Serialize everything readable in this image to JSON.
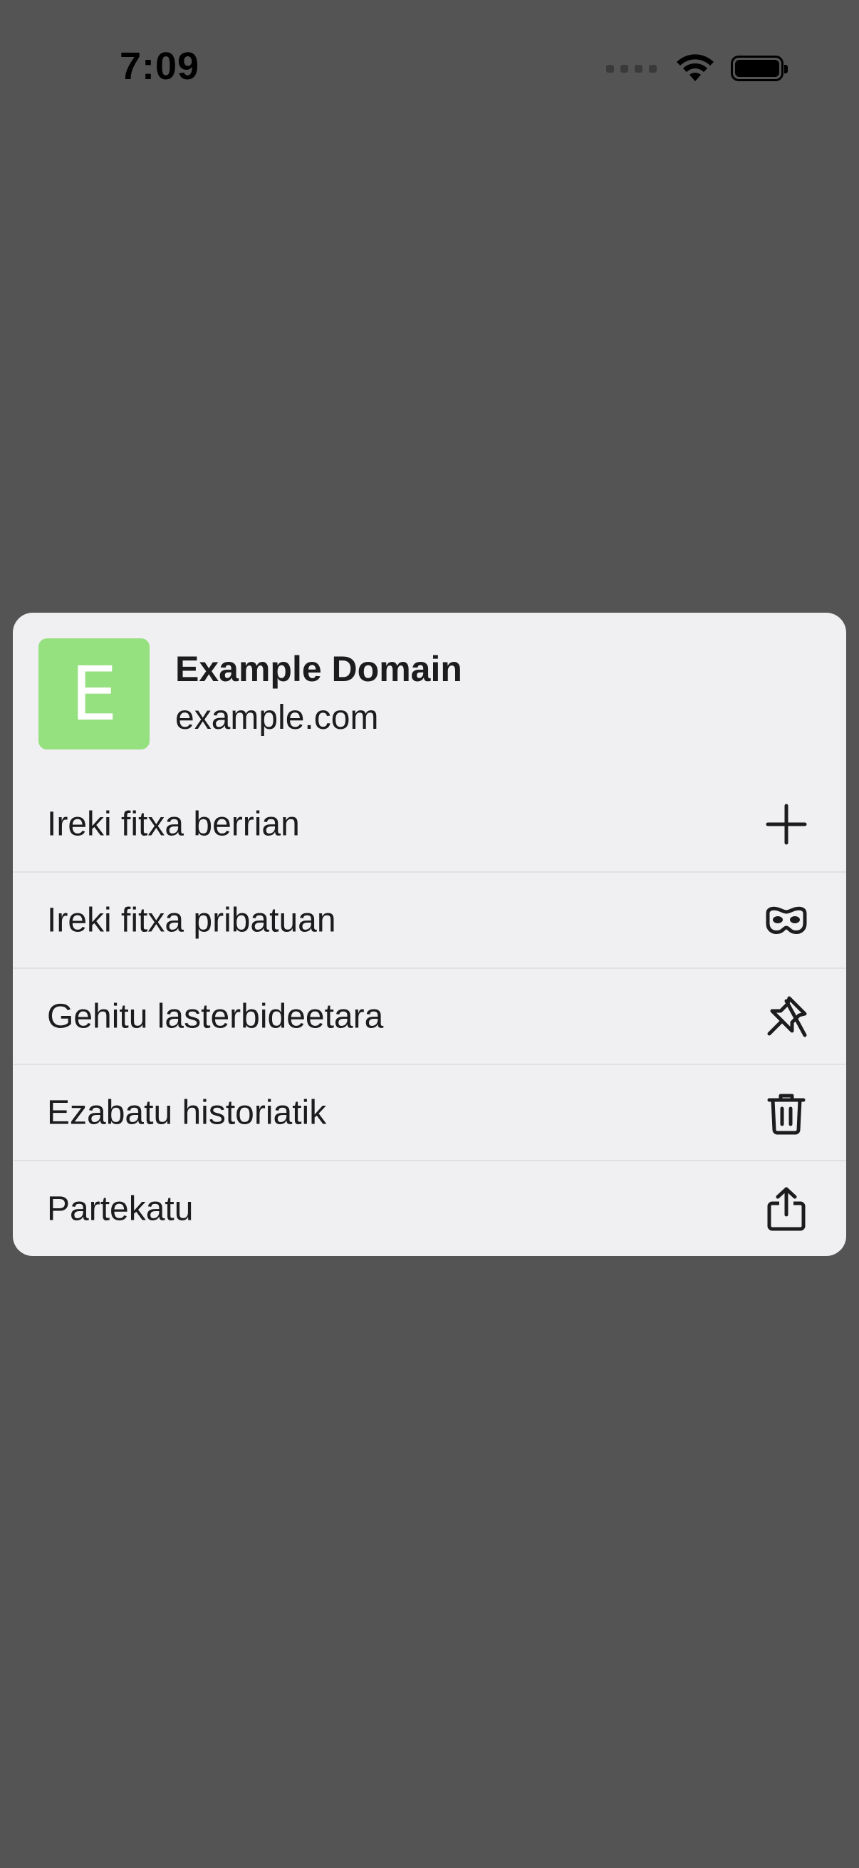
{
  "status_bar": {
    "time": "7:09"
  },
  "menu": {
    "header": {
      "favicon_letter": "E",
      "favicon_color": "#95e07f",
      "title": "Example Domain",
      "url": "example.com"
    },
    "items": [
      {
        "label": "Ireki fitxa berrian",
        "icon": "plus-icon"
      },
      {
        "label": "Ireki fitxa pribatuan",
        "icon": "mask-icon"
      },
      {
        "label": "Gehitu lasterbideetara",
        "icon": "pin-icon"
      },
      {
        "label": "Ezabatu historiatik",
        "icon": "trash-icon"
      },
      {
        "label": "Partekatu",
        "icon": "share-icon"
      }
    ]
  },
  "colors": {
    "backdrop": "#545454",
    "card": "#f0f0f2",
    "text": "#1c1c1e",
    "separator": "#e1e1e4"
  }
}
